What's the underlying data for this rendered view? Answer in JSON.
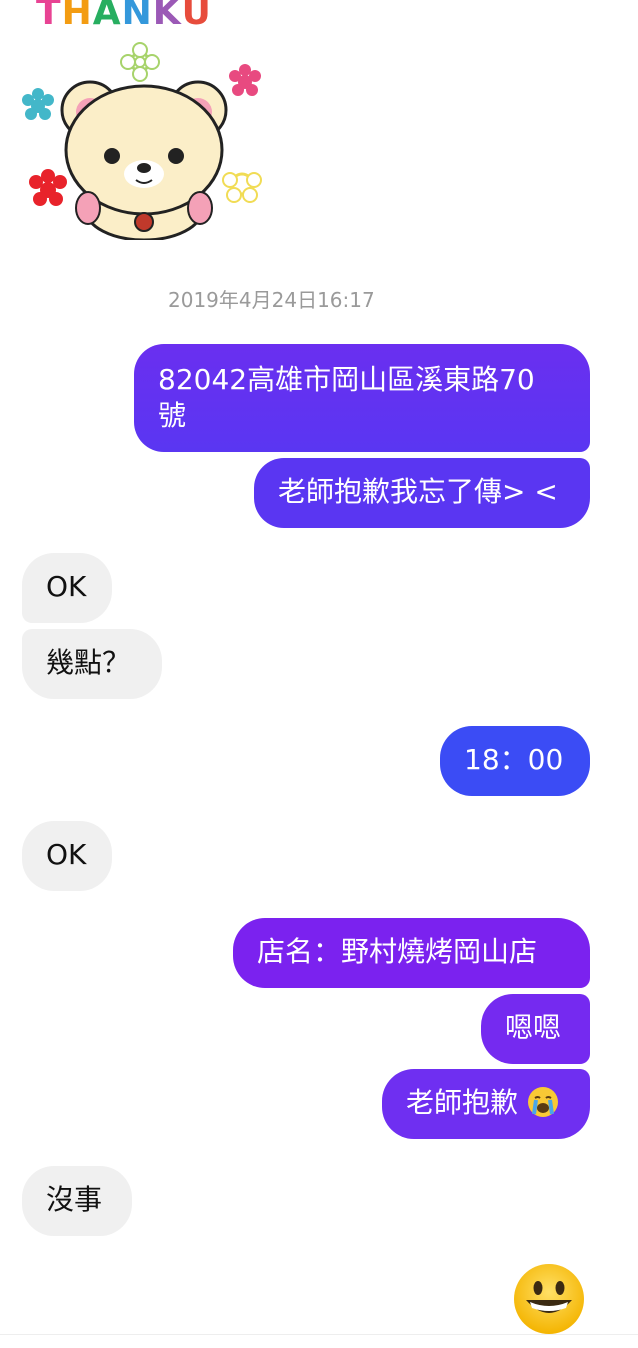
{
  "sticker": {
    "text": "THANK U",
    "icon": "bear-thank-you-sticker",
    "letter_colors": [
      "#e84393",
      "#f39c12",
      "#27ae60",
      "#3498db",
      "#9b59b6",
      "#e74c3c",
      "#e84393"
    ]
  },
  "timestamp": "2019年4月24日16:17",
  "messages": [
    {
      "side": "out",
      "text_line1": "82042高雄市岡山區溪東路70",
      "text_line2": "號"
    },
    {
      "side": "out",
      "text": "老師抱歉我忘了傳> <"
    },
    {
      "side": "in",
      "text": "OK"
    },
    {
      "side": "in",
      "text": "幾點？"
    },
    {
      "side": "out",
      "text": "18：00"
    },
    {
      "side": "in",
      "text": "OK"
    },
    {
      "side": "out",
      "text": "店名：野村燒烤岡山店"
    },
    {
      "side": "out",
      "text": "嗯嗯"
    },
    {
      "side": "out",
      "text": "老師抱歉",
      "emoji": "crying-face-icon"
    },
    {
      "side": "in",
      "text": "沒事"
    },
    {
      "side": "out",
      "emoji": "grinning-face-icon"
    }
  ],
  "colors": {
    "outgoing_gradient_top": "#6a2ff0",
    "outgoing_gradient_bottom": "#3b4cf5",
    "incoming_bg": "#f0f0f0",
    "timestamp_text": "#9a9a9a"
  }
}
